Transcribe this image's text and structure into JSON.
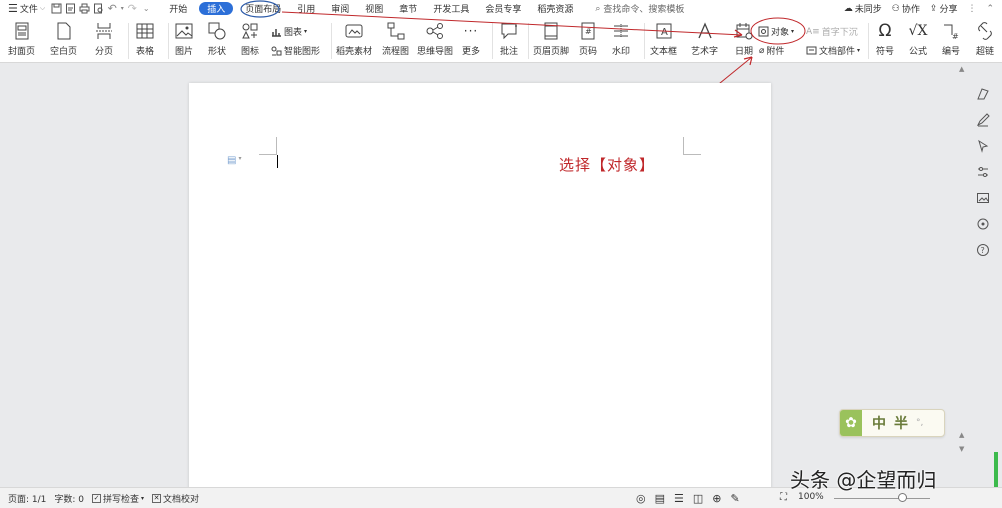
{
  "menubar": {
    "file_label": "文件",
    "tabs": [
      "开始",
      "插入",
      "页面布局",
      "引用",
      "审阅",
      "视图",
      "章节",
      "开发工具",
      "会员专享",
      "稻壳资源"
    ],
    "active_tab_index": 1,
    "search_placeholder": "查找命令、搜索模板",
    "unsynced": "未同步",
    "collaborate": "协作",
    "share": "分享"
  },
  "ribbon": {
    "buttons": [
      "封面页",
      "空白页",
      "分页",
      "表格",
      "图片",
      "形状",
      "图标",
      "稻壳素材",
      "流程图",
      "思维导图",
      "更多",
      "批注",
      "页眉页脚",
      "页码",
      "水印",
      "文本框",
      "艺术字",
      "日期",
      "符号",
      "公式",
      "编号",
      "超链"
    ],
    "chart_label": "图表",
    "smart_shape_label": "智能图形",
    "object_label": "对象",
    "drop_cap_label": "首字下沉",
    "attachment_label": "附件",
    "doc_parts_label": "文档部件"
  },
  "document": {
    "instruction": "选择【对象】"
  },
  "widget": {
    "text": "中半",
    "suffix": "°,"
  },
  "statusbar": {
    "page": "页面: 1/1",
    "words": "字数: 0",
    "spellcheck": "拼写检查",
    "proofread": "文档校对",
    "zoom": "100%"
  },
  "watermark": "头条 @企望而归",
  "colors": {
    "active_tab": "#2c6fd8",
    "annotation": "#c0282b"
  }
}
